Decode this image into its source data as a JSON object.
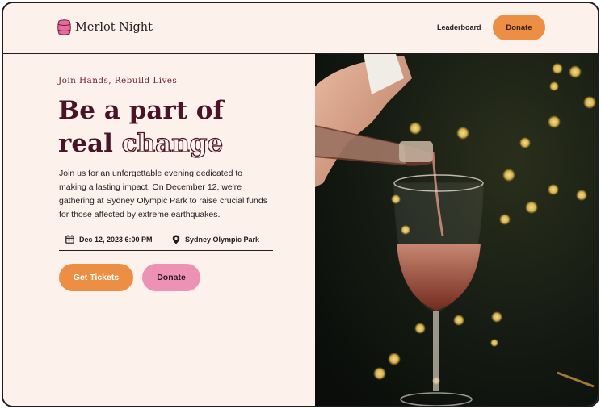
{
  "brand": {
    "name": "Merlot Night",
    "logo_icon": "wine-barrel-icon",
    "accent": "#EC8E43",
    "accent_pink": "#EE92B5",
    "text_dark": "#4A1428"
  },
  "nav": {
    "leaderboard_label": "Leaderboard",
    "donate_label": "Donate"
  },
  "hero": {
    "eyebrow": "Join Hands, Rebuild Lives",
    "headline_line1": "Be a part of",
    "headline_line2_plain": "real",
    "headline_line2_outline": "change",
    "description": "Join us for an unforgettable evening dedicated to making a lasting impact. On December 12, we're gathering at Sydney Olympic Park to raise crucial funds for those affected by extreme earthquakes.",
    "date": "Dec 12, 2023 6:00 PM",
    "date_icon": "calendar-icon",
    "location": "Sydney Olympic Park",
    "location_icon": "map-pin-icon",
    "primary_cta": "Get Tickets",
    "secondary_cta": "Donate",
    "image_description_icon": "wine-pour-photo"
  }
}
